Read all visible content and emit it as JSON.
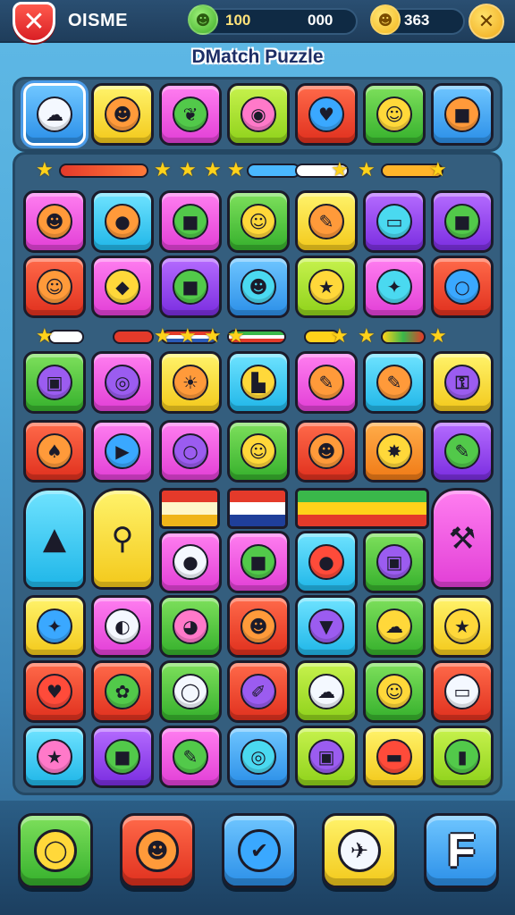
{
  "header": {
    "game_name": "OISME",
    "stat_green": "100",
    "stat_middle": "000",
    "stat_gold": "363",
    "close_symbol": "✕",
    "settings_symbol": "✕",
    "coin_green_symbol": "☻",
    "coin_gold_symbol": "☻"
  },
  "title": "DMatch Puzzle",
  "top_row": [
    {
      "color": "blue",
      "icon": "cloud-icon",
      "glyph": "☁",
      "selected": true
    },
    {
      "color": "yellow",
      "icon": "fox-face-icon",
      "glyph": "☻"
    },
    {
      "color": "pink",
      "icon": "leaf-icon",
      "glyph": "❦"
    },
    {
      "color": "lime",
      "icon": "ring-icon",
      "glyph": "◉"
    },
    {
      "color": "red",
      "icon": "heart-bubble-icon",
      "glyph": "♥"
    },
    {
      "color": "green",
      "icon": "smiley-icon",
      "glyph": "☺"
    },
    {
      "color": "blue",
      "icon": "cube-icon",
      "glyph": "■"
    }
  ],
  "grid_rows": [
    [
      {
        "color": "pink",
        "icon": "cat-face-icon",
        "glyph": "☻",
        "ic": "orange"
      },
      {
        "color": "cyan",
        "icon": "football-icon",
        "glyph": "●",
        "ic": "orange"
      },
      {
        "color": "pink",
        "icon": "gift-box-icon",
        "glyph": "■",
        "ic": "green"
      },
      {
        "color": "green",
        "icon": "bear-face-icon",
        "glyph": "☺",
        "ic": "yellow"
      },
      {
        "color": "yellow",
        "icon": "pencil-icon",
        "glyph": "✎",
        "ic": "orange"
      },
      {
        "color": "purple",
        "icon": "monitor-icon",
        "glyph": "▭",
        "ic": "cyan"
      },
      {
        "color": "purple",
        "icon": "cube-icon",
        "glyph": "■",
        "ic": "green"
      }
    ],
    [
      {
        "color": "red",
        "icon": "smiley-icon",
        "glyph": "☺",
        "ic": "orange"
      },
      {
        "color": "pink",
        "icon": "diamond-icon",
        "glyph": "◆",
        "ic": "yellow"
      },
      {
        "color": "purple",
        "icon": "cube-icon",
        "glyph": "■",
        "ic": "green"
      },
      {
        "color": "blue",
        "icon": "blob-monster-icon",
        "glyph": "☻",
        "ic": "cyan"
      },
      {
        "color": "lime",
        "icon": "star-icon",
        "glyph": "★",
        "ic": "yellow"
      },
      {
        "color": "pink",
        "icon": "chat-bubble-icon",
        "glyph": "✦",
        "ic": "cyan"
      },
      {
        "color": "red",
        "icon": "magnifier-icon",
        "glyph": "○",
        "ic": "blue"
      }
    ],
    [
      {
        "color": "green",
        "icon": "robot-icon",
        "glyph": "▣",
        "ic": "purple"
      },
      {
        "color": "pink",
        "icon": "ring-icon",
        "glyph": "◎",
        "ic": "purple"
      },
      {
        "color": "yellow",
        "icon": "sun-face-icon",
        "glyph": "☀",
        "ic": "orange"
      },
      {
        "color": "cyan",
        "icon": "chair-icon",
        "glyph": "▙",
        "ic": "yellow"
      },
      {
        "color": "pink",
        "icon": "pencil-icon",
        "glyph": "✎",
        "ic": "orange"
      },
      {
        "color": "cyan",
        "icon": "pencil-icon",
        "glyph": "✎",
        "ic": "orange"
      },
      {
        "color": "yellow",
        "icon": "key-icon",
        "glyph": "⚿",
        "ic": "purple"
      }
    ],
    [
      {
        "color": "red",
        "icon": "acorn-icon",
        "glyph": "♠",
        "ic": "orange"
      },
      {
        "color": "pink",
        "icon": "play-triangle-icon",
        "glyph": "▶",
        "ic": "blue"
      },
      {
        "color": "pink",
        "icon": "magnifier-icon",
        "glyph": "○",
        "ic": "purple"
      },
      {
        "color": "green",
        "icon": "bear-face-icon",
        "glyph": "☺",
        "ic": "yellow"
      },
      {
        "color": "red",
        "icon": "fox-face-icon",
        "glyph": "☻",
        "ic": "orange"
      },
      {
        "color": "orange",
        "icon": "sparkle-icon",
        "glyph": "✸",
        "ic": "yellow"
      },
      {
        "color": "purple",
        "icon": "pencil-icon",
        "glyph": "✎",
        "ic": "green"
      }
    ]
  ],
  "special_row": {
    "tall_left": {
      "color": "cyan",
      "icon": "ice-cream-icon",
      "glyph": "▲"
    },
    "tall_left2": {
      "color": "yellow",
      "icon": "key-icon",
      "glyph": "⚲"
    },
    "tall_right": {
      "color": "pink",
      "icon": "hammer-icon",
      "glyph": "⚒"
    }
  },
  "grid_rows_2": [
    [
      {
        "color": "pink",
        "icon": "snowball-icon",
        "glyph": "●",
        "ic": "white"
      },
      {
        "color": "pink",
        "icon": "gift-box-icon",
        "glyph": "■",
        "ic": "green"
      },
      {
        "color": "cyan",
        "icon": "football-icon",
        "glyph": "●",
        "ic": "red"
      },
      {
        "color": "green",
        "icon": "robot-icon",
        "glyph": "▣",
        "ic": "purple"
      }
    ],
    [
      {
        "color": "yellow",
        "icon": "turtle-icon",
        "glyph": "✦",
        "ic": "blue"
      },
      {
        "color": "pink",
        "icon": "beach-ball-icon",
        "glyph": "◐",
        "ic": "white"
      },
      {
        "color": "green",
        "icon": "pie-chart-icon",
        "glyph": "◕",
        "ic": "pink"
      },
      {
        "color": "red",
        "icon": "cat-face-icon",
        "glyph": "☻",
        "ic": "orange"
      },
      {
        "color": "cyan",
        "icon": "ice-cream-icon",
        "glyph": "▼",
        "ic": "purple"
      },
      {
        "color": "green",
        "icon": "chat-bubble-icon",
        "glyph": "☁",
        "ic": "yellow"
      },
      {
        "color": "yellow",
        "icon": "star-icon",
        "glyph": "★",
        "ic": "yellow"
      }
    ],
    [
      {
        "color": "red",
        "icon": "heart-icon",
        "glyph": "♥",
        "ic": "red"
      },
      {
        "color": "red",
        "icon": "chat-bubble-icon",
        "glyph": "✿",
        "ic": "green"
      },
      {
        "color": "green",
        "icon": "ring-icon",
        "glyph": "◯",
        "ic": "white"
      },
      {
        "color": "red",
        "icon": "paintbrush-icon",
        "glyph": "✐",
        "ic": "purple"
      },
      {
        "color": "lime",
        "icon": "hat-icon",
        "glyph": "☁",
        "ic": "white"
      },
      {
        "color": "green",
        "icon": "smiley-icon",
        "glyph": "☺",
        "ic": "yellow"
      },
      {
        "color": "red",
        "icon": "mug-icon",
        "glyph": "▭",
        "ic": "white"
      }
    ],
    [
      {
        "color": "cyan",
        "icon": "star-icon",
        "glyph": "★",
        "ic": "pink"
      },
      {
        "color": "purple",
        "icon": "cube-icon",
        "glyph": "■",
        "ic": "green"
      },
      {
        "color": "pink",
        "icon": "pencil-icon",
        "glyph": "✎",
        "ic": "green"
      },
      {
        "color": "blue",
        "icon": "target-ring-icon",
        "glyph": "◎",
        "ic": "cyan"
      },
      {
        "color": "lime",
        "icon": "robot-icon",
        "glyph": "▣",
        "ic": "purple"
      },
      {
        "color": "yellow",
        "icon": "eraser-icon",
        "glyph": "▬",
        "ic": "red"
      },
      {
        "color": "lime",
        "icon": "battery-icon",
        "glyph": "▮",
        "ic": "green"
      }
    ]
  ],
  "bottom_buttons": [
    {
      "color": "green",
      "icon": "chat-ring-icon",
      "glyph": "◯",
      "ic": "yellow"
    },
    {
      "color": "red",
      "icon": "cat-face-icon",
      "glyph": "☻",
      "ic": "orange"
    },
    {
      "color": "blue",
      "icon": "checkmark-icon",
      "glyph": "✔",
      "ic": "blue"
    },
    {
      "color": "yellow",
      "icon": "paper-plane-icon",
      "glyph": "✈",
      "ic": "white"
    },
    {
      "color": "blue",
      "icon": "letter-f-icon",
      "label": "F"
    }
  ]
}
